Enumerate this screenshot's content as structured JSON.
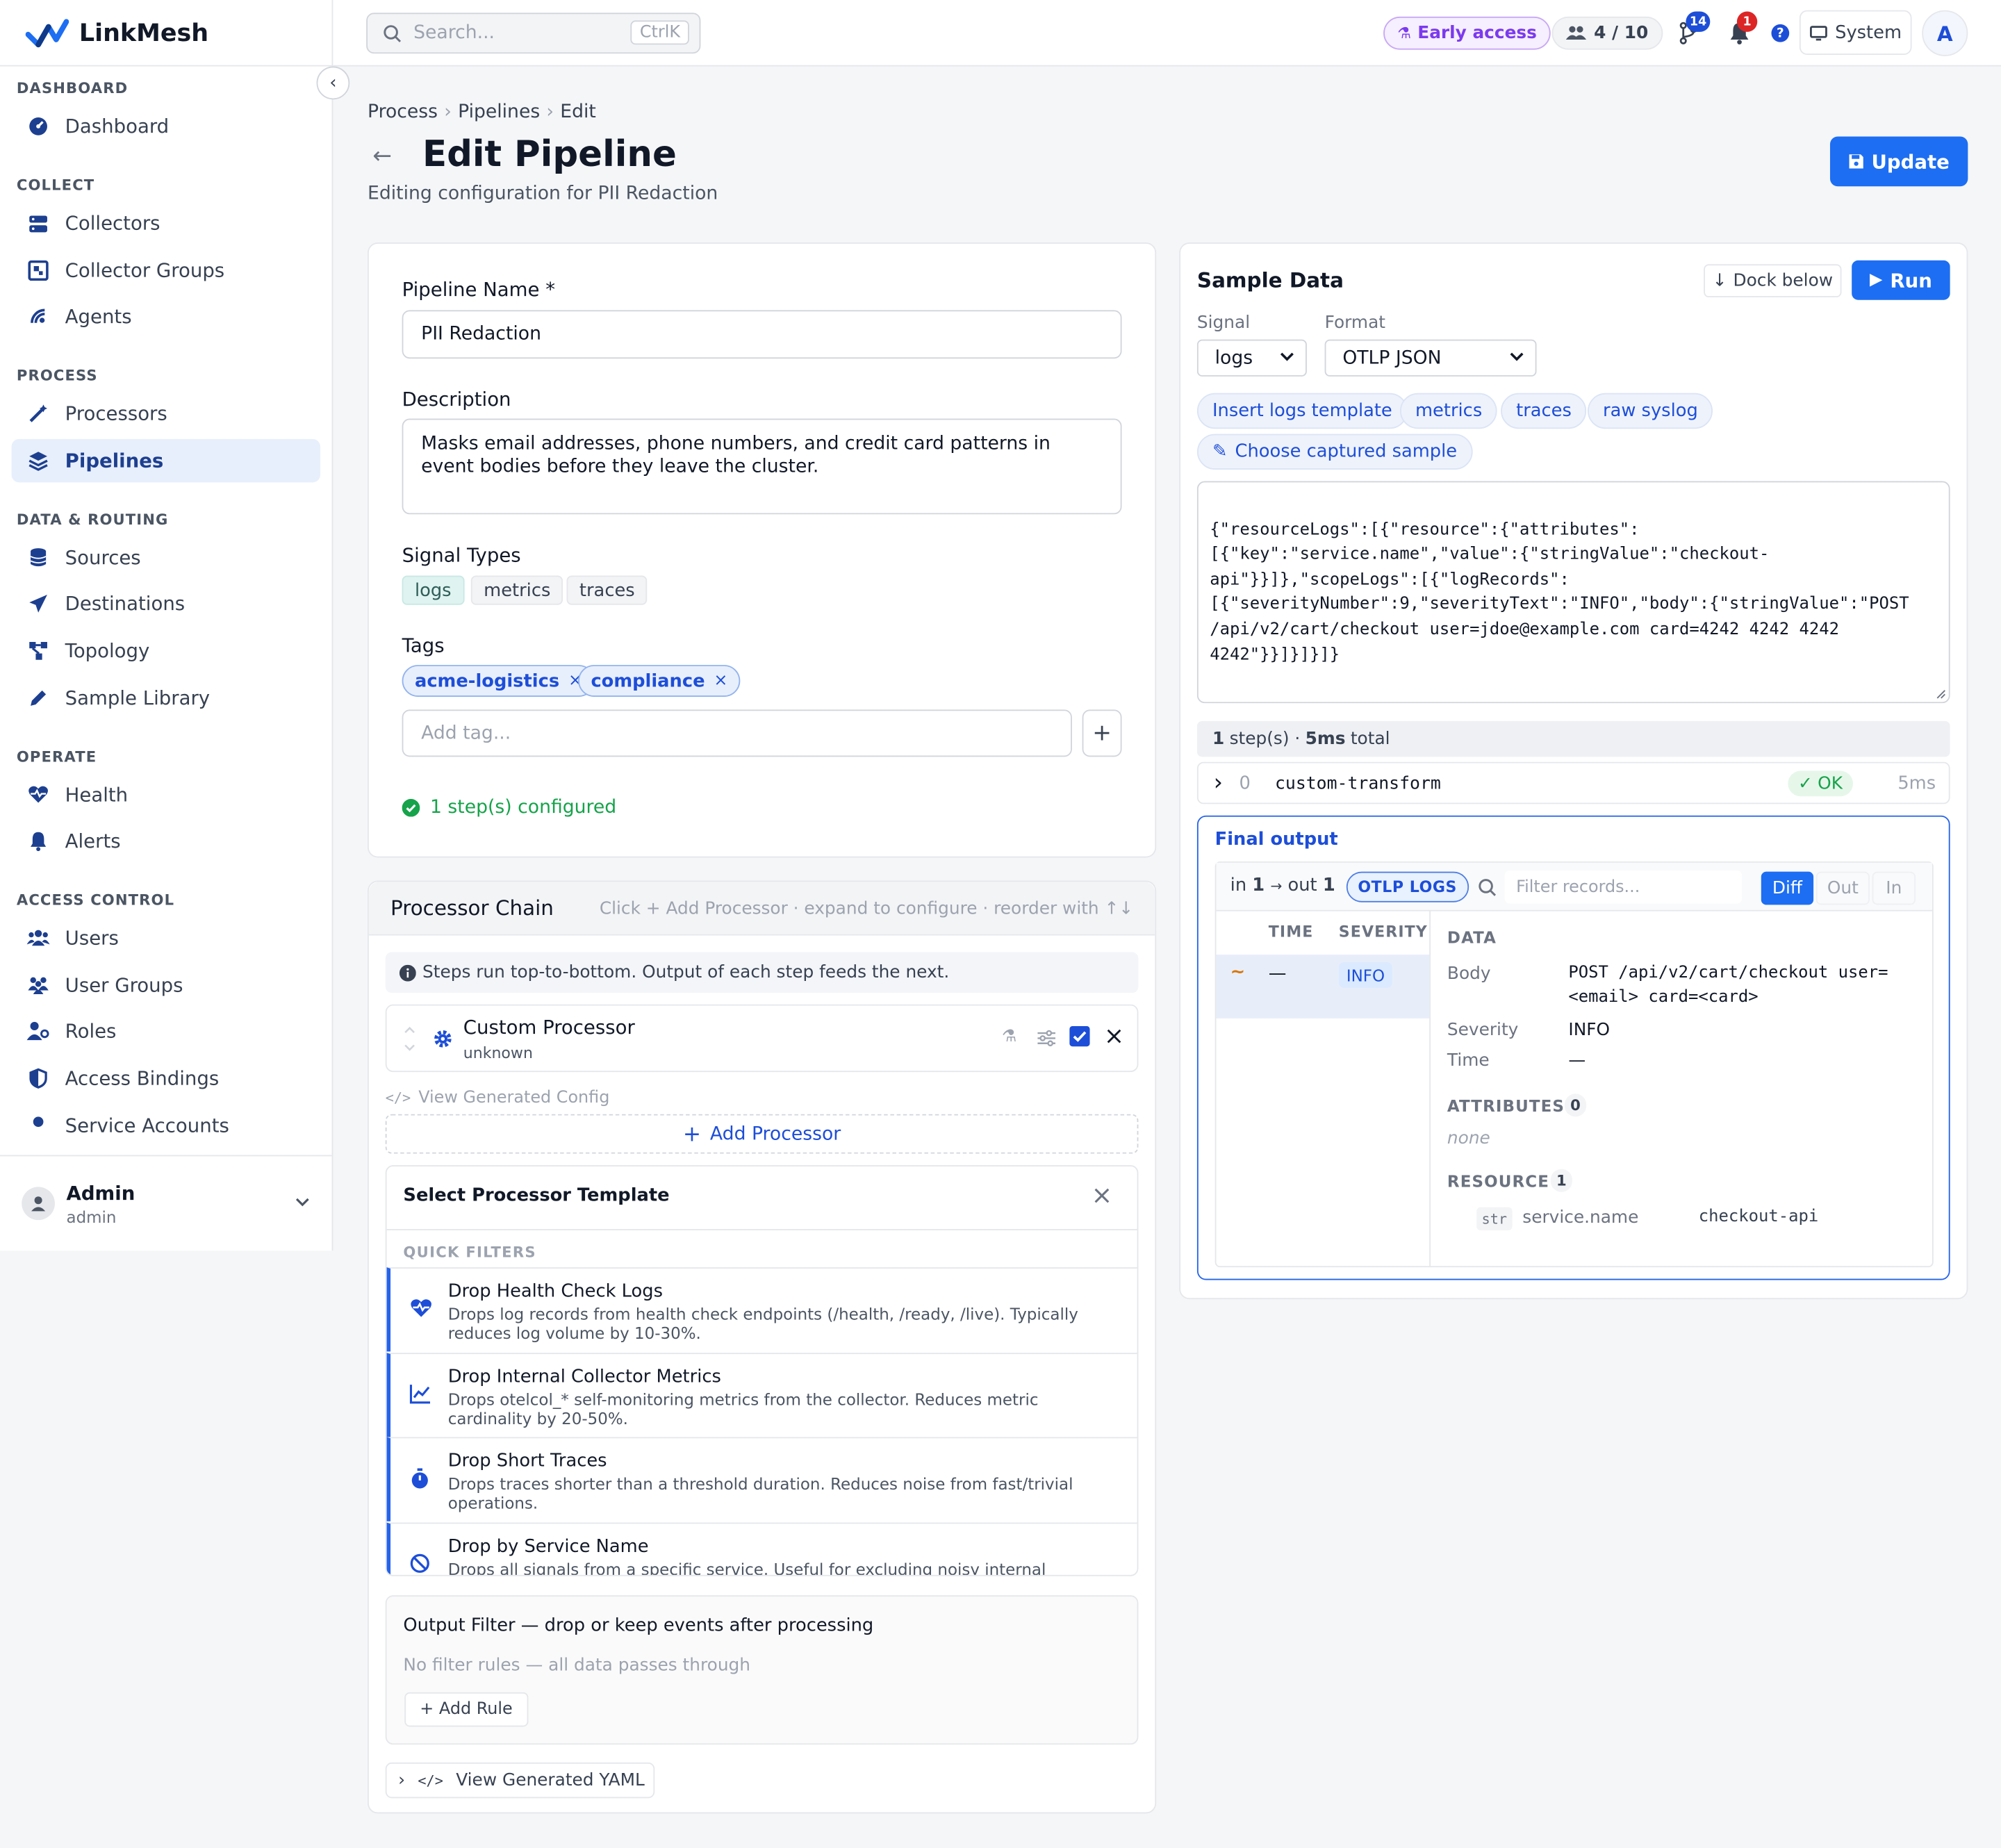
{
  "brand": {
    "name": "LinkMesh",
    "accent": "#1d6ef2"
  },
  "search": {
    "placeholder": "Search...",
    "shortcut": "CtrlK"
  },
  "header": {
    "early_access": "Early access",
    "seats": "4 / 10",
    "git_badge": "14",
    "alerts_badge": "1",
    "theme": "System",
    "avatar": "A"
  },
  "sidebar": {
    "sections": [
      {
        "title": "DASHBOARD",
        "items": [
          {
            "label": "Dashboard",
            "icon": "dashboard-icon"
          }
        ]
      },
      {
        "title": "COLLECT",
        "items": [
          {
            "label": "Collectors",
            "icon": "server-icon"
          },
          {
            "label": "Collector Groups",
            "icon": "group-icon"
          },
          {
            "label": "Agents",
            "icon": "signal-icon"
          }
        ]
      },
      {
        "title": "PROCESS",
        "items": [
          {
            "label": "Processors",
            "icon": "wand-icon"
          },
          {
            "label": "Pipelines",
            "icon": "layers-icon",
            "active": true
          }
        ]
      },
      {
        "title": "DATA & ROUTING",
        "items": [
          {
            "label": "Sources",
            "icon": "database-icon"
          },
          {
            "label": "Destinations",
            "icon": "send-icon"
          },
          {
            "label": "Topology",
            "icon": "topology-icon"
          },
          {
            "label": "Sample Library",
            "icon": "pen-icon"
          }
        ]
      },
      {
        "title": "OPERATE",
        "items": [
          {
            "label": "Health",
            "icon": "heart-pulse-icon"
          },
          {
            "label": "Alerts",
            "icon": "bell-icon"
          }
        ]
      },
      {
        "title": "ACCESS CONTROL",
        "items": [
          {
            "label": "Users",
            "icon": "users-icon"
          },
          {
            "label": "User Groups",
            "icon": "user-group-icon"
          },
          {
            "label": "Roles",
            "icon": "user-key-icon"
          },
          {
            "label": "Access Bindings",
            "icon": "shield-icon"
          },
          {
            "label": "Service Accounts",
            "icon": "key-icon"
          }
        ]
      }
    ],
    "user": {
      "name": "Admin",
      "role": "admin"
    }
  },
  "breadcrumb": [
    "Process",
    "Pipelines",
    "Edit"
  ],
  "page": {
    "title": "Edit Pipeline",
    "subtitle": "Editing configuration for PII Redaction",
    "update_label": "Update"
  },
  "form": {
    "name_label": "Pipeline Name *",
    "name_value": "PII Redaction",
    "desc_label": "Description",
    "desc_value": "Masks email addresses, phone numbers, and credit card patterns in event bodies before they leave the cluster.",
    "signal_label": "Signal Types",
    "signals": [
      "logs",
      "metrics",
      "traces"
    ],
    "tags_label": "Tags",
    "tags": [
      "acme-logistics",
      "compliance"
    ],
    "tag_placeholder": "Add tag...",
    "steps_status": "1 step(s) configured"
  },
  "chain": {
    "title": "Processor Chain",
    "hint": "Click + Add Processor · expand to configure · reorder with ↑↓",
    "info": "Steps run top-to-bottom. Output of each step feeds the next.",
    "processor": {
      "name": "Custom Processor",
      "sub": "unknown"
    },
    "view_config": "View Generated Config",
    "add_processor": "Add Processor",
    "template_title": "Select Processor Template",
    "quick_filters": "QUICK FILTERS",
    "templates": [
      {
        "name": "Drop Health Check Logs",
        "desc": "Drops log records from health check endpoints (/health, /ready, /live). Typically reduces log volume by 10-30%.",
        "icon": "heart-pulse-icon"
      },
      {
        "name": "Drop Internal Collector Metrics",
        "desc": "Drops otelcol_* self-monitoring metrics from the collector. Reduces metric cardinality by 20-50%.",
        "icon": "chart-line-icon"
      },
      {
        "name": "Drop Short Traces",
        "desc": "Drops traces shorter than a threshold duration. Reduces noise from fast/trivial operations.",
        "icon": "stopwatch-icon"
      },
      {
        "name": "Drop by Service Name",
        "desc": "Drops all signals from a specific service. Useful for excluding noisy internal services.",
        "icon": "ban-icon"
      }
    ],
    "output_filter_title": "Output Filter — drop or keep events after processing",
    "output_filter_empty": "No filter rules — all data passes through",
    "add_rule": "+ Add Rule",
    "view_yaml": "View Generated YAML"
  },
  "sample": {
    "title": "Sample Data",
    "dock": "Dock below",
    "run": "Run",
    "signal_label": "Signal",
    "signal_value": "logs",
    "format_label": "Format",
    "format_value": "OTLP JSON",
    "chips": [
      "Insert logs template",
      "metrics",
      "traces",
      "raw syslog"
    ],
    "captured": "Choose captured sample",
    "json_lines": [
      "{\"resourceLogs\":[{\"resource\":{\"attributes\":",
      "[{\"key\":\"service.name\",\"value\":{\"stringValue\":\"checkout-",
      "api\"}}]},\"scopeLogs\":[{\"logRecords\":",
      "[{\"severityNumber\":9,\"severityText\":\"INFO\",\"body\":{\"stringValue\":\"POST",
      "/api/v2/cart/checkout user=jdoe@example.com card=4242 4242 4242",
      "4242\"}}]}]}]}"
    ],
    "steps_count": "1",
    "steps_suffix": "step(s) ·",
    "total_time": "5ms",
    "total_suffix": "total",
    "step": {
      "index": "0",
      "name": "custom-transform",
      "status": "OK",
      "time": "5ms"
    },
    "final": {
      "title": "Final output",
      "in_label": "in",
      "in_count": "1",
      "out_label": "out",
      "out_count": "1",
      "badge": "OTLP LOGS",
      "filter_placeholder": "Filter records...",
      "tabs": [
        "Diff",
        "Out",
        "In"
      ],
      "col_time": "TIME",
      "col_severity": "SEVERITY",
      "row": {
        "marker": "~",
        "time": "—",
        "severity": "INFO"
      },
      "data_title": "DATA",
      "body_key": "Body",
      "body_value_1": "POST /api/v2/cart/checkout user=",
      "body_value_2": "<email> card=<card>",
      "sev_key": "Severity",
      "sev_value": "INFO",
      "time_key": "Time",
      "time_value": "—",
      "attributes_title": "ATTRIBUTES",
      "attributes_count": "0",
      "attributes_none": "none",
      "resource_title": "RESOURCE",
      "resource_count": "1",
      "resource_type": "str",
      "resource_key": "service.name",
      "resource_value": "checkout-api"
    }
  }
}
